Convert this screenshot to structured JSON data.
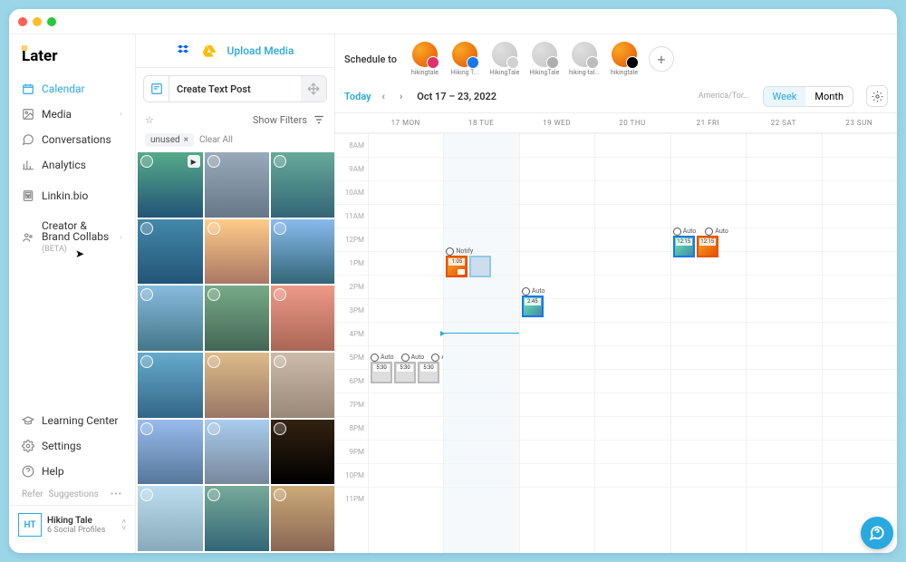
{
  "logo": "Later",
  "nav": {
    "calendar": "Calendar",
    "media": "Media",
    "conversations": "Conversations",
    "analytics": "Analytics",
    "linkinbio": "Linkin.bio",
    "collabs": "Creator & Brand Collabs",
    "collabs_beta": "(BETA)",
    "learning": "Learning Center",
    "settings": "Settings",
    "help": "Help"
  },
  "refer": {
    "label": "Refer",
    "suggestions": "Suggestions"
  },
  "account": {
    "initials": "HT",
    "name": "Hiking Tale",
    "sub": "6 Social Profiles"
  },
  "upload": {
    "label": "Upload Media"
  },
  "create_post": "Create Text Post",
  "filters": {
    "show": "Show Filters"
  },
  "chips": {
    "unused": "unused",
    "clear": "Clear All"
  },
  "schedule": {
    "label": "Schedule to",
    "profiles": [
      {
        "name": "hikingtale",
        "net": "instagram",
        "color": "#E1306C",
        "dim": false
      },
      {
        "name": "Hiking T...",
        "net": "facebook",
        "color": "#1877f2",
        "dim": false
      },
      {
        "name": "HikingTale",
        "net": "twitter",
        "color": "#1DA1F2",
        "dim": true
      },
      {
        "name": "HikingTale",
        "net": "pinterest",
        "color": "#E60023",
        "dim": true
      },
      {
        "name": "hiking-tal...",
        "net": "linkedin",
        "color": "#0A66C2",
        "dim": true
      },
      {
        "name": "hikingtale",
        "net": "tiktok",
        "color": "#000",
        "dim": false
      }
    ]
  },
  "calhead": {
    "today": "Today",
    "range": "Oct 17 – 23, 2022",
    "tz": "America/Tor...",
    "week": "Week",
    "month": "Month"
  },
  "days": [
    "17 MON",
    "18 TUE",
    "19 WED",
    "20 THU",
    "21 FRI",
    "22 SAT",
    "23 SUN"
  ],
  "hours": [
    "8AM",
    "9AM",
    "10AM",
    "11AM",
    "12PM",
    "1PM",
    "2PM",
    "3PM",
    "4PM",
    "5PM",
    "6PM",
    "7PM",
    "8PM",
    "9PM",
    "10PM",
    "11PM"
  ],
  "events": {
    "tue_notify": {
      "tag": "Notify",
      "time": "1:05"
    },
    "wed_auto": {
      "tag": "Auto",
      "time": "2:45"
    },
    "fri_auto1": {
      "tag": "Auto",
      "time": "12:15"
    },
    "fri_auto2": {
      "tag": "Auto",
      "time": "12:15"
    },
    "mon_auto1": {
      "tag": "Auto",
      "time": "5:30"
    },
    "mon_auto2": {
      "tag": "Auto",
      "time": "5:30"
    },
    "mon_auto3": {
      "tag": "Auto",
      "time": "5:30"
    }
  }
}
